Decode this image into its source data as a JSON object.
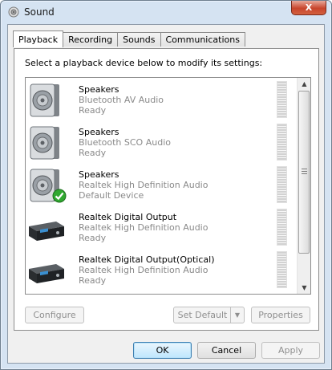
{
  "window": {
    "title": "Sound",
    "close_label": "X"
  },
  "tabs": [
    {
      "label": "Playback",
      "active": true
    },
    {
      "label": "Recording",
      "active": false
    },
    {
      "label": "Sounds",
      "active": false
    },
    {
      "label": "Communications",
      "active": false
    }
  ],
  "instruction": "Select a playback device below to modify its settings:",
  "devices": [
    {
      "name": "Speakers",
      "description": "Bluetooth AV Audio",
      "status": "Ready",
      "icon": "speaker-icon",
      "default": false
    },
    {
      "name": "Speakers",
      "description": "Bluetooth SCO Audio",
      "status": "Ready",
      "icon": "speaker-icon",
      "default": false
    },
    {
      "name": "Speakers",
      "description": "Realtek High Definition Audio",
      "status": "Default Device",
      "icon": "speaker-icon",
      "default": true
    },
    {
      "name": "Realtek Digital Output",
      "description": "Realtek High Definition Audio",
      "status": "Ready",
      "icon": "digital-receiver-icon",
      "default": false
    },
    {
      "name": "Realtek Digital Output(Optical)",
      "description": "Realtek High Definition Audio",
      "status": "Ready",
      "icon": "digital-receiver-icon",
      "default": false
    }
  ],
  "panel_buttons": {
    "configure": "Configure",
    "set_default": "Set Default",
    "properties": "Properties"
  },
  "dialog_buttons": {
    "ok": "OK",
    "cancel": "Cancel",
    "apply": "Apply"
  },
  "colors": {
    "default_check": "#2fa82f",
    "title_bar": "#d5e3f2",
    "secondary_text": "#8a8a8a"
  }
}
